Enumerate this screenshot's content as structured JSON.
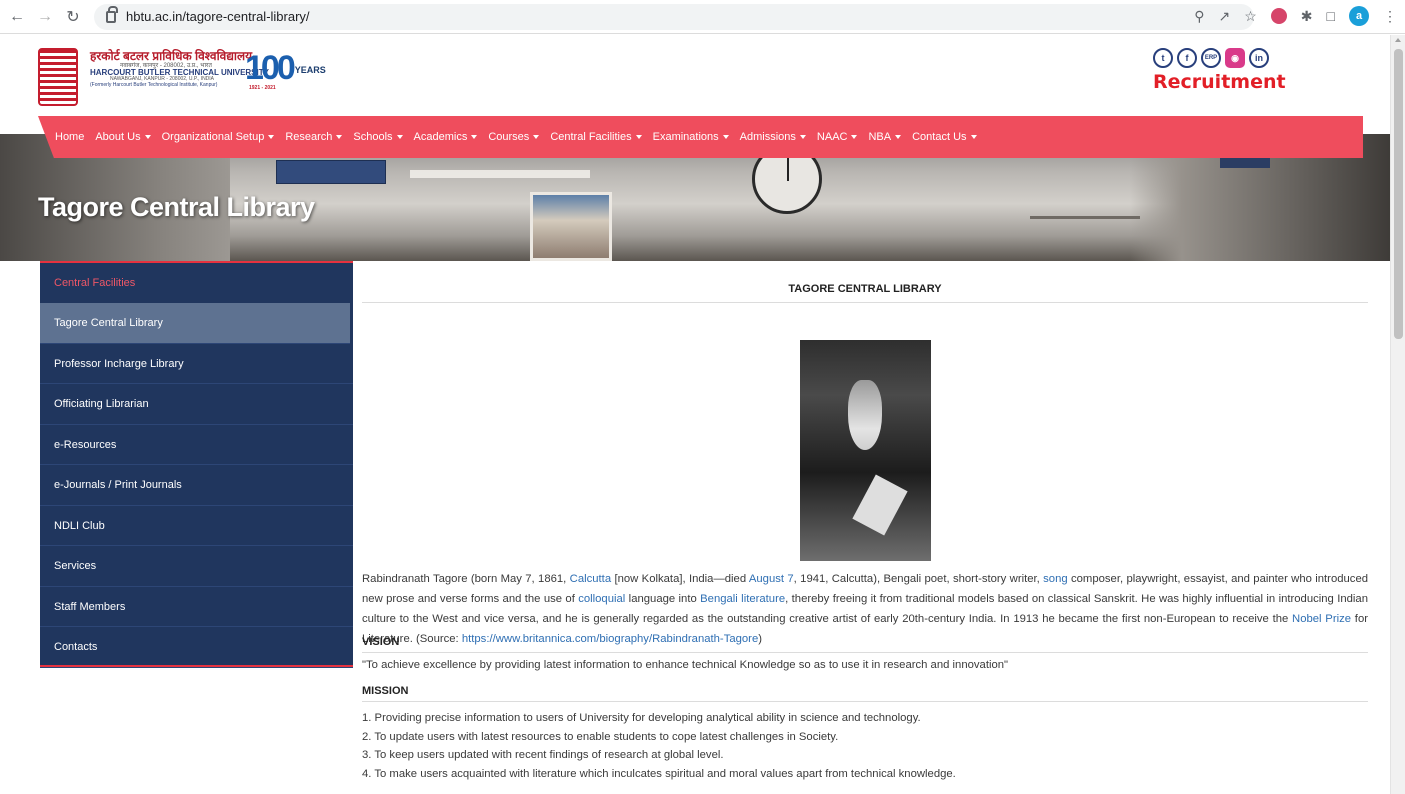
{
  "browser": {
    "url": "hbtu.ac.in/tagore-central-library/",
    "profile_initial": "a"
  },
  "header": {
    "name_hindi": "हरकोर्ट बटलर प्राविधिक विश्वविद्यालय",
    "address_hindi": "नवाबगंज, कानपुर - 208002, उ.प्र., भारत",
    "name_english": "HARCOURT BUTLER TECHNICAL UNIVERSITY",
    "address_english": "NAWABGANJ, KANPUR - 208002, U.P., INDIA",
    "formerly": "(Formerly Harcourt Butler Technological Institute, Kanpur)",
    "years_number": "100",
    "years_word": "YEARS",
    "years_range": "1921 - 2021",
    "socials": [
      "t",
      "f",
      "ERP",
      "ig",
      "in"
    ],
    "recruitment": "Recruitment"
  },
  "banner": {
    "page_title": "Tagore Central Library"
  },
  "menu": {
    "items": [
      {
        "label": "Home",
        "dropdown": false
      },
      {
        "label": "About Us",
        "dropdown": true
      },
      {
        "label": "Organizational Setup",
        "dropdown": true
      },
      {
        "label": "Research",
        "dropdown": true
      },
      {
        "label": "Schools",
        "dropdown": true
      },
      {
        "label": "Academics",
        "dropdown": true
      },
      {
        "label": "Courses",
        "dropdown": true
      },
      {
        "label": "Central Facilities",
        "dropdown": true
      },
      {
        "label": "Examinations",
        "dropdown": true
      },
      {
        "label": "Admissions",
        "dropdown": true
      },
      {
        "label": "NAAC",
        "dropdown": true
      },
      {
        "label": "NBA",
        "dropdown": true
      },
      {
        "label": "Contact Us",
        "dropdown": true
      }
    ]
  },
  "sidebar": {
    "heading": "Central Facilities",
    "items": [
      {
        "label": "Tagore Central Library",
        "active": true
      },
      {
        "label": "Professor Incharge Library",
        "active": false
      },
      {
        "label": "Officiating Librarian",
        "active": false
      },
      {
        "label": "e-Resources",
        "active": false
      },
      {
        "label": "e-Journals / Print Journals",
        "active": false
      },
      {
        "label": "NDLI Club",
        "active": false
      },
      {
        "label": "Services",
        "active": false
      },
      {
        "label": "Staff Members",
        "active": false
      },
      {
        "label": "Contacts",
        "active": false
      }
    ]
  },
  "content": {
    "heading": "TAGORE CENTRAL LIBRARY",
    "bio": {
      "t1": "Rabindranath Tagore (born May 7, 1861, ",
      "link_calcutta": "Calcutta",
      "t2": " [now Kolkata], India—died ",
      "link_aug7": "August 7",
      "t3": ", 1941, Calcutta), Bengali poet, short-story writer, ",
      "link_song": "song",
      "t4": " composer, playwright, essayist, and painter who introduced new prose and verse forms and the use of ",
      "link_colloquial": "colloquial",
      "t5": " language into ",
      "link_bengali": "Bengali literature",
      "t6": ", thereby freeing it from traditional models based on classical Sanskrit. He was highly influential in introducing Indian culture to the West and vice versa, and he is generally regarded as the outstanding creative artist of early 20th-century India. In 1913 he became the first non-European to receive the ",
      "link_nobel": "Nobel Prize",
      "t7": " for Literature. (Source: ",
      "link_source": "https://www.britannica.com/biography/Rabindranath-Tagore",
      "t8": ")"
    },
    "vision_heading": "VISION",
    "vision_text": "\"To achieve excellence by providing latest information to enhance technical Knowledge so as to use it in research and innovation\"",
    "mission_heading": "MISSION",
    "mission_items": [
      "1. Providing precise information to users of University for developing analytical ability in science and technology.",
      "2. To update users with latest resources to enable students to cope latest challenges in Society.",
      "3. To keep users updated with recent findings of research at global level.",
      "4. To make users acquainted with literature which inculcates spiritual and moral values apart from technical knowledge."
    ]
  },
  "colors": {
    "menu_bar": "#ef4d5d",
    "sidebar_bg": "#20365e",
    "sidebar_active": "#5e7291",
    "link": "#2f6fb3",
    "recruitment": "#e21f27"
  }
}
